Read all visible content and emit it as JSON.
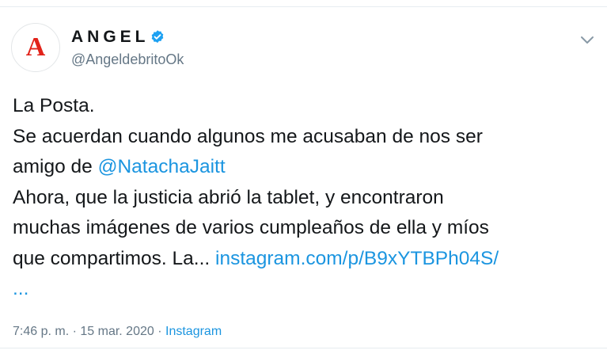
{
  "tweet": {
    "avatar_letter": "A",
    "display_name": "ANGEL",
    "handle": "@AngeldebritoOk",
    "body": {
      "line1": "La Posta.",
      "line2": "Se acuerdan cuando algunos me acusaban de nos ser",
      "line3_prefix": "amigo de ",
      "mention": "@NatachaJaitt",
      "line4": "Ahora, que la justicia abrió la tablet, y encontraron",
      "line5": "muchas imágenes de varios cumpleaños de ella y míos",
      "line6_prefix": "que compartimos. La... ",
      "link": "instagram.com/p/B9xYTBPh04S/",
      "link_cont": "..."
    },
    "meta": {
      "time": "7:46 p. m.",
      "separator": " · ",
      "date": "15 mar. 2020",
      "separator2": " · ",
      "source": "Instagram"
    }
  },
  "colors": {
    "link": "#1b95e0",
    "verified": "#1da1f2",
    "brand": "#e2231a",
    "muted": "#657786"
  },
  "icons": {
    "verified": "verified-badge-icon",
    "caret": "chevron-down-icon"
  }
}
